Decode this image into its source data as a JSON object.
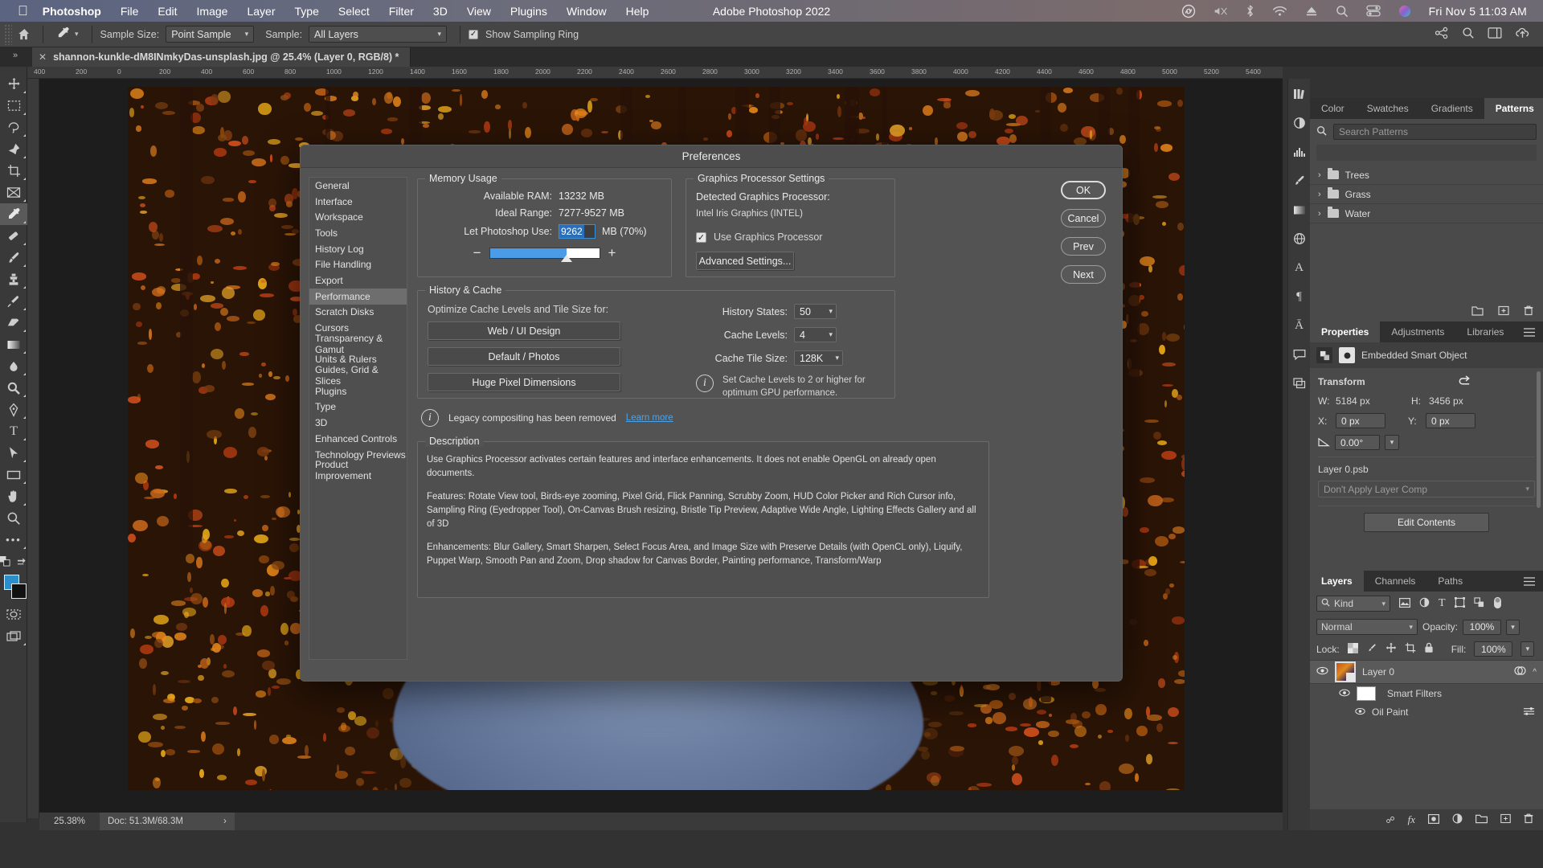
{
  "menubar": {
    "apple_icon": "apple-icon",
    "items": [
      "Photoshop",
      "File",
      "Edit",
      "Image",
      "Layer",
      "Type",
      "Select",
      "Filter",
      "3D",
      "View",
      "Plugins",
      "Window",
      "Help"
    ],
    "status_icons": [
      "creative-cloud-icon",
      "volume-muted-icon",
      "bluetooth-icon",
      "wifi-icon",
      "eject-icon",
      "spotlight-search-icon",
      "control-center-icon",
      "siri-icon"
    ],
    "clock": "Fri Nov 5  11:03 AM"
  },
  "window": {
    "title": "Adobe Photoshop 2022"
  },
  "options_bar": {
    "home_icon": "home-icon",
    "tool_icon": "eyedropper-tool-icon",
    "sample_size_label": "Sample Size:",
    "sample_size_value": "Point Sample",
    "sample_label": "Sample:",
    "sample_value": "All Layers",
    "show_sampling_ring_label": "Show Sampling Ring",
    "show_sampling_ring_checked": true,
    "right_icons": [
      "share-icon",
      "search-icon",
      "workspace-icon",
      "cloud-upload-icon"
    ]
  },
  "document_tab": {
    "close_icon": "close-icon",
    "title": "shannon-kunkle-dM8INmkyDas-unsplash.jpg @ 25.4% (Layer 0, RGB/8) *",
    "collapse_icon": "double-chevron-right-icon"
  },
  "toolbar": {
    "tools": [
      {
        "name": "move-tool",
        "glyph": "✥"
      },
      {
        "name": "rectangular-marquee-tool",
        "glyph": "▭"
      },
      {
        "name": "lasso-tool",
        "glyph": "⌁"
      },
      {
        "name": "object-selection-tool",
        "glyph": "✦"
      },
      {
        "name": "crop-tool",
        "glyph": "⌗"
      },
      {
        "name": "frame-tool",
        "glyph": "⊠"
      },
      {
        "name": "eyedropper-tool",
        "glyph": "⟋",
        "active": true
      },
      {
        "name": "spot-healing-brush-tool",
        "glyph": "✎"
      },
      {
        "name": "brush-tool",
        "glyph": "🖌"
      },
      {
        "name": "clone-stamp-tool",
        "glyph": "⚲"
      },
      {
        "name": "history-brush-tool",
        "glyph": "↯"
      },
      {
        "name": "eraser-tool",
        "glyph": "◣"
      },
      {
        "name": "gradient-tool",
        "glyph": "▤"
      },
      {
        "name": "blur-tool",
        "glyph": "◠"
      },
      {
        "name": "dodge-tool",
        "glyph": "◉"
      },
      {
        "name": "pen-tool",
        "glyph": "✒"
      },
      {
        "name": "horizontal-type-tool",
        "glyph": "T"
      },
      {
        "name": "path-selection-tool",
        "glyph": "➤"
      },
      {
        "name": "rectangle-tool",
        "glyph": "▭"
      },
      {
        "name": "hand-tool",
        "glyph": "✋"
      },
      {
        "name": "zoom-tool",
        "glyph": "⌕"
      },
      {
        "name": "edit-toolbar-more",
        "glyph": "•••"
      }
    ],
    "foreground_color": "#2d8fc9",
    "background_color": "#111111",
    "quick-mask-icon": "quick-mask-icon",
    "screen-mode-icon": "screen-mode-icon"
  },
  "ruler": {
    "ticks": [
      "400",
      "200",
      "0",
      "200",
      "400",
      "600",
      "800",
      "1000",
      "1200",
      "1400",
      "1600",
      "1800",
      "2000",
      "2200",
      "2400",
      "2600",
      "2800",
      "3000",
      "3200",
      "3400",
      "3600",
      "3800",
      "4000",
      "4200",
      "4400",
      "4600",
      "4800",
      "5000",
      "5200",
      "5400"
    ]
  },
  "status_bar": {
    "zoom": "25.38%",
    "doc": "Doc: 51.3M/68.3M",
    "expand_icon": "chevron-right-icon"
  },
  "preferences": {
    "title": "Preferences",
    "nav_items": [
      "General",
      "Interface",
      "Workspace",
      "Tools",
      "History Log",
      "File Handling",
      "Export",
      "Performance",
      "Scratch Disks",
      "Cursors",
      "Transparency & Gamut",
      "Units & Rulers",
      "Guides, Grid & Slices",
      "Plugins",
      "Type",
      "3D",
      "Enhanced Controls",
      "Technology Previews",
      "Product Improvement"
    ],
    "nav_selected": "Performance",
    "memory": {
      "group_label": "Memory Usage",
      "available_ram_label": "Available RAM:",
      "available_ram_value": "13232 MB",
      "ideal_range_label": "Ideal Range:",
      "ideal_range_value": "7277-9527 MB",
      "let_use_label": "Let Photoshop Use:",
      "let_use_value": "9262",
      "let_use_suffix": "MB (70%)",
      "minus_label": "−",
      "plus_label": "+",
      "slider_percent": 70
    },
    "graphics": {
      "group_label": "Graphics Processor Settings",
      "detected_label": "Detected Graphics Processor:",
      "detected_value": "Intel Iris Graphics (INTEL)",
      "use_gpu_label": "Use Graphics Processor",
      "use_gpu_checked": true,
      "advanced_button": "Advanced Settings..."
    },
    "history_cache": {
      "group_label": "History & Cache",
      "optimize_label": "Optimize Cache Levels and Tile Size for:",
      "buttons": [
        "Web / UI Design",
        "Default / Photos",
        "Huge Pixel Dimensions"
      ],
      "history_states_label": "History States:",
      "history_states_value": "50",
      "cache_levels_label": "Cache Levels:",
      "cache_levels_value": "4",
      "cache_tile_label": "Cache Tile Size:",
      "cache_tile_value": "128K",
      "info_icon": "info-icon",
      "info_text": "Set Cache Levels to 2 or higher for optimum GPU performance."
    },
    "legacy_notice": {
      "info_icon": "info-icon",
      "text": "Legacy compositing has been removed",
      "link": "Learn more"
    },
    "description": {
      "group_label": "Description",
      "p1": "Use Graphics Processor activates certain features and interface enhancements. It does not enable OpenGL on already open documents.",
      "p2": "Features: Rotate View tool, Birds-eye zooming, Pixel Grid, Flick Panning, Scrubby Zoom, HUD Color Picker and Rich Cursor info, Sampling Ring (Eyedropper Tool), On-Canvas Brush resizing, Bristle Tip Preview, Adaptive Wide Angle, Lighting Effects Gallery and all of 3D",
      "p3": "Enhancements: Blur Gallery, Smart Sharpen, Select Focus Area, and Image Size with Preserve Details (with OpenCL only), Liquify, Puppet Warp, Smooth Pan and Zoom, Drop shadow for Canvas Border, Painting performance, Transform/Warp"
    },
    "buttons": {
      "ok": "OK",
      "cancel": "Cancel",
      "prev": "Prev",
      "next": "Next"
    }
  },
  "right_dock": {
    "rail_icons": [
      "cc-libraries-icon",
      "adjustments-icon",
      "histogram-icon",
      "brush-settings-icon",
      "gradients-icon",
      "3d-icon",
      "character-icon",
      "paragraph-icon",
      "glyphs-icon",
      "comments-icon",
      "layer-comps-icon"
    ],
    "swatches_panel": {
      "tabs": [
        "Color",
        "Swatches",
        "Gradients",
        "Patterns"
      ],
      "active_tab": "Patterns",
      "menu_icon": "panel-menu-icon",
      "search_icon": "search-icon",
      "search_placeholder": "Search Patterns",
      "folders": [
        "Trees",
        "Grass",
        "Water"
      ],
      "folder_icon": "folder-icon",
      "chevron_icon": "chevron-right-icon",
      "footer_icons": [
        "new-group-icon",
        "new-pattern-icon",
        "delete-icon"
      ]
    },
    "properties_panel": {
      "tabs": [
        "Properties",
        "Adjustments",
        "Libraries"
      ],
      "active_tab": "Properties",
      "menu_icon": "panel-menu-icon",
      "object_type_icon": "smart-object-icon",
      "mask_icon": "mask-icon",
      "object_type": "Embedded Smart Object",
      "transform_label": "Transform",
      "reset_icon": "reset-transform-icon",
      "w_label": "W:",
      "w_value": "5184 px",
      "h_label": "H:",
      "h_value": "3456 px",
      "x_label": "X:",
      "x_value": "0 px",
      "y_label": "Y:",
      "y_value": "0 px",
      "angle_icon": "angle-icon",
      "angle_value": "0.00°",
      "file_name": "Layer 0.psb",
      "layer_comp_value": "Don't Apply Layer Comp",
      "edit_contents_button": "Edit Contents"
    },
    "layers_panel": {
      "tabs": [
        "Layers",
        "Channels",
        "Paths"
      ],
      "active_tab": "Layers",
      "menu_icon": "panel-menu-icon",
      "filter_label": "Kind",
      "filter_search_icon": "search-icon",
      "filter_icons": [
        "pixel-filter-icon",
        "adjustment-filter-icon",
        "type-filter-icon",
        "shape-filter-icon",
        "smart-object-filter-icon"
      ],
      "filter_toggle_icon": "filter-toggle-icon",
      "blend_mode": "Normal",
      "opacity_label": "Opacity:",
      "opacity_value": "100%",
      "lock_label": "Lock:",
      "lock_icons": [
        "lock-transparent-pixels-icon",
        "lock-image-pixels-icon",
        "lock-position-icon",
        "lock-artboard-icon",
        "lock-all-icon"
      ],
      "fill_label": "Fill:",
      "fill_value": "100%",
      "layers": [
        {
          "name": "Layer 0",
          "visible": true,
          "eye_icon": "eye-icon",
          "thumb": "layer-thumbnail",
          "smart_icon": "smart-object-badge",
          "fx_icon": "smart-filter-icon",
          "expand_icon": "chevron-up-icon"
        },
        {
          "name": "Smart Filters",
          "visible": true,
          "eye_icon": "eye-icon",
          "thumb": "filter-mask-thumbnail"
        },
        {
          "name": "Oil Paint",
          "visible": true,
          "eye_icon": "eye-icon",
          "options_icon": "blending-options-icon"
        }
      ],
      "footer_icons": [
        "link-layers-icon",
        "layer-style-icon",
        "layer-mask-icon",
        "adjustment-layer-icon",
        "new-group-icon",
        "new-layer-icon",
        "delete-layer-icon"
      ]
    }
  }
}
